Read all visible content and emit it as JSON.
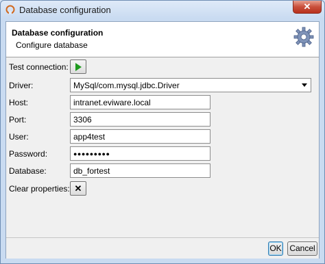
{
  "window": {
    "title": "Database configuration",
    "close_label": "✕"
  },
  "header": {
    "title": "Database configuration",
    "subtitle": "Configure database",
    "icon": "gear-icon"
  },
  "form": {
    "test_connection": {
      "label": "Test connection:",
      "icon": "play-icon"
    },
    "driver": {
      "label": "Driver:",
      "value": "MySql/com.mysql.jdbc.Driver"
    },
    "host": {
      "label": "Host:",
      "value": "intranet.eviware.local"
    },
    "port": {
      "label": "Port:",
      "value": "3306"
    },
    "user": {
      "label": "User:",
      "value": "app4test"
    },
    "password": {
      "label": "Password:",
      "value": "●●●●●●●●●"
    },
    "database": {
      "label": "Database:",
      "value": "db_fortest"
    },
    "clear_properties": {
      "label": "Clear properties:",
      "button_label": "✕"
    }
  },
  "footer": {
    "ok_label": "OK",
    "cancel_label": "Cancel"
  },
  "colors": {
    "play_green": "#1e9a1e",
    "close_red": "#c9503c",
    "title_bar": "#c9dbf1"
  }
}
